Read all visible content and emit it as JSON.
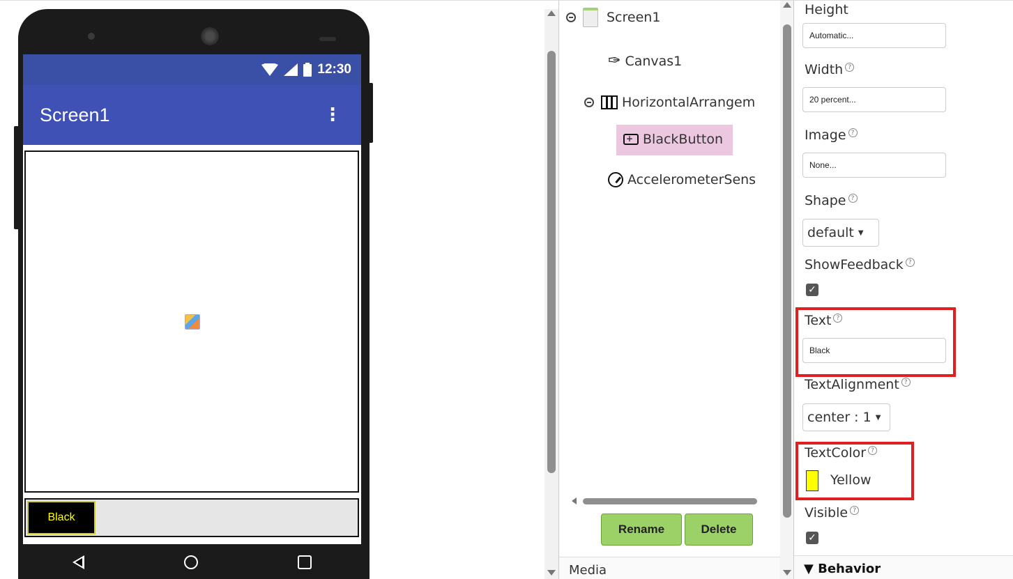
{
  "phone": {
    "status_time": "12:30",
    "app_title": "Screen1",
    "button_label": "Black",
    "button_text_color": "#ffff00",
    "appbar_color": "#3f51b5",
    "statusbar_color": "#3a4fa6"
  },
  "components": {
    "tree": [
      {
        "label": "Screen1",
        "icon": "screen-icon"
      },
      {
        "label": "Canvas1",
        "icon": "paintbrush-icon"
      },
      {
        "label": "HorizontalArrangem",
        "icon": "horizontal-arrangement-icon"
      },
      {
        "label": "BlackButton",
        "icon": "button-icon",
        "selected": true
      },
      {
        "label": "AccelerometerSens",
        "icon": "accelerometer-icon"
      }
    ],
    "rename_label": "Rename",
    "delete_label": "Delete",
    "media_label": "Media"
  },
  "properties": {
    "height": {
      "label": "Height",
      "value": "Automatic..."
    },
    "width": {
      "label": "Width",
      "value": "20 percent..."
    },
    "image": {
      "label": "Image",
      "value": "None..."
    },
    "shape": {
      "label": "Shape",
      "value": "default"
    },
    "show_feedback": {
      "label": "ShowFeedback",
      "checked": true
    },
    "text": {
      "label": "Text",
      "value": "Black"
    },
    "text_alignment": {
      "label": "TextAlignment",
      "value": "center : 1"
    },
    "text_color": {
      "label": "TextColor",
      "value": "Yellow",
      "swatch": "#ffff00"
    },
    "visible": {
      "label": "Visible",
      "checked": true
    },
    "help_glyph": "?",
    "behavior_label": "Behavior",
    "highlight_color": "#e02020"
  }
}
